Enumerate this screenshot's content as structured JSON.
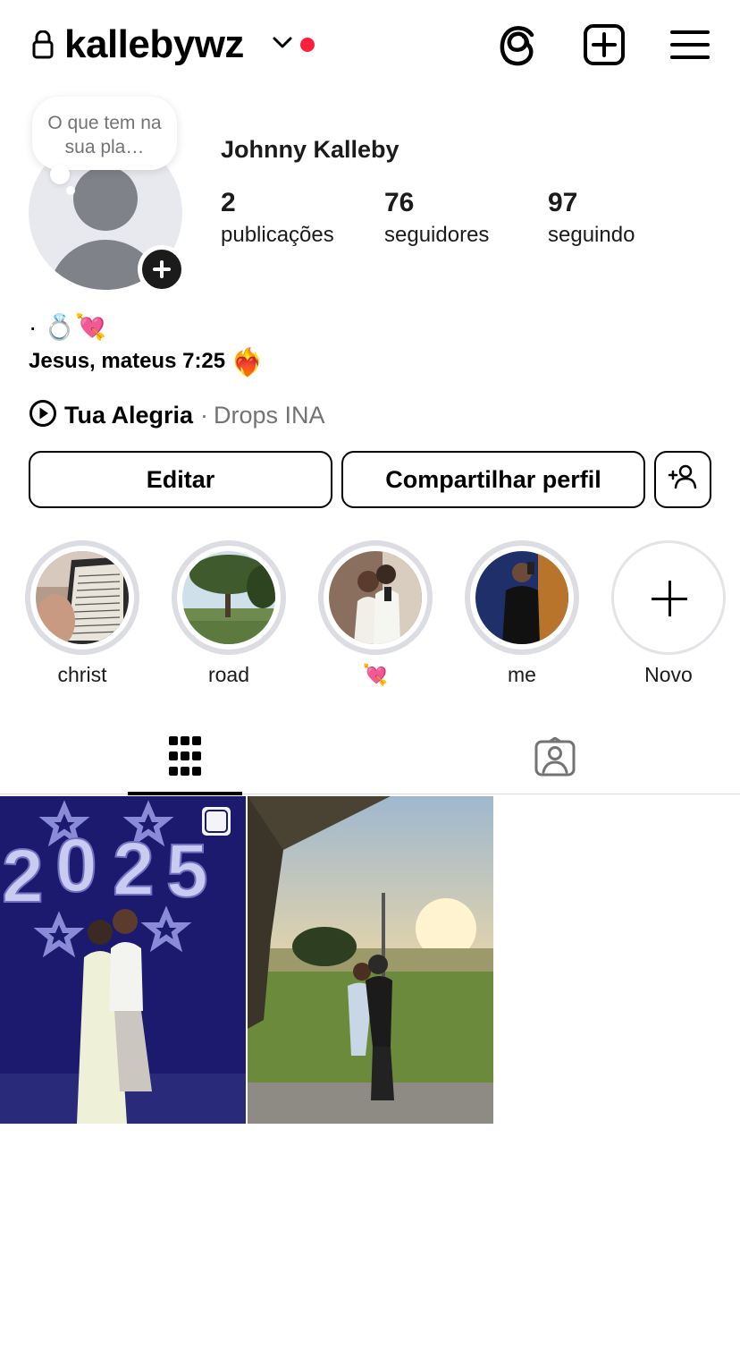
{
  "header": {
    "username": "kallebywz",
    "icons": [
      "lock-icon",
      "chevron-down-icon",
      "threads-icon",
      "create-post-icon",
      "menu-icon"
    ],
    "notification_color": "#ff1f3d"
  },
  "profile": {
    "note": "O que tem na sua pla…",
    "full_name": "Johnny Kalleby",
    "stats": {
      "posts_count": "2",
      "posts_label": "publicações",
      "followers_count": "76",
      "followers_label": "seguidores",
      "following_count": "97",
      "following_label": "seguindo"
    },
    "bio_line1": "· 💍💘",
    "bio_line2": "Jesus, mateus 7:25",
    "bio_line2_emoji": "❤️‍🔥",
    "music": {
      "song": "Tua Alegria",
      "separator": "·",
      "artist": "Drops INA"
    }
  },
  "buttons": {
    "edit": "Editar",
    "share": "Compartilhar perfil"
  },
  "highlights": [
    {
      "name": "christ"
    },
    {
      "name": "road"
    },
    {
      "name": "💘"
    },
    {
      "name": "me"
    },
    {
      "name": "Novo"
    }
  ],
  "tabs": [
    "grid-icon",
    "tagged-icon"
  ],
  "posts": [
    {
      "type": "carousel",
      "description": "photo"
    },
    {
      "type": "single",
      "description": "photo"
    }
  ]
}
